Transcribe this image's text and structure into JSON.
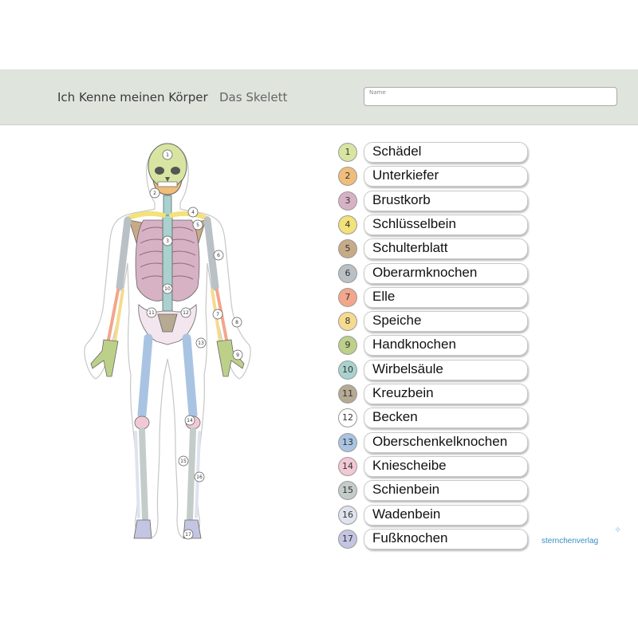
{
  "header": {
    "title": "Ich Kenne meinen Körper",
    "subtitle": "Das Skelett",
    "name_label": "Name"
  },
  "legend": [
    {
      "num": "1",
      "label": "Schädel",
      "color": "#d8e5a2"
    },
    {
      "num": "2",
      "label": "Unterkiefer",
      "color": "#f0bd7a"
    },
    {
      "num": "3",
      "label": "Brustkorb",
      "color": "#d7b2c4"
    },
    {
      "num": "4",
      "label": "Schlüsselbein",
      "color": "#f3e17a"
    },
    {
      "num": "5",
      "label": "Schulterblatt",
      "color": "#c7aa86"
    },
    {
      "num": "6",
      "label": "Oberarmknochen",
      "color": "#b9c1c6"
    },
    {
      "num": "7",
      "label": "Elle",
      "color": "#f2a68c"
    },
    {
      "num": "8",
      "label": "Speiche",
      "color": "#f5db8f"
    },
    {
      "num": "9",
      "label": "Handknochen",
      "color": "#bdd08a"
    },
    {
      "num": "10",
      "label": "Wirbelsäule",
      "color": "#a9d2cf"
    },
    {
      "num": "11",
      "label": "Kreuzbein",
      "color": "#b6aa92"
    },
    {
      "num": "12",
      "label": "Becken",
      "color": "#ffffff"
    },
    {
      "num": "13",
      "label": "Oberschenkelknochen",
      "color": "#a9c4e2"
    },
    {
      "num": "14",
      "label": "Kniescheibe",
      "color": "#f2c8d4"
    },
    {
      "num": "15",
      "label": "Schienbein",
      "color": "#c4ccca"
    },
    {
      "num": "16",
      "label": "Wadenbein",
      "color": "#dfe3ee"
    },
    {
      "num": "17",
      "label": "Fußknochen",
      "color": "#c4c5e2"
    }
  ],
  "diagram_labels": [
    "1",
    "2",
    "3",
    "4",
    "5",
    "6",
    "7",
    "8",
    "9",
    "10",
    "11",
    "12",
    "13",
    "14",
    "15",
    "16",
    "17"
  ],
  "brand": "sternchenverlag"
}
